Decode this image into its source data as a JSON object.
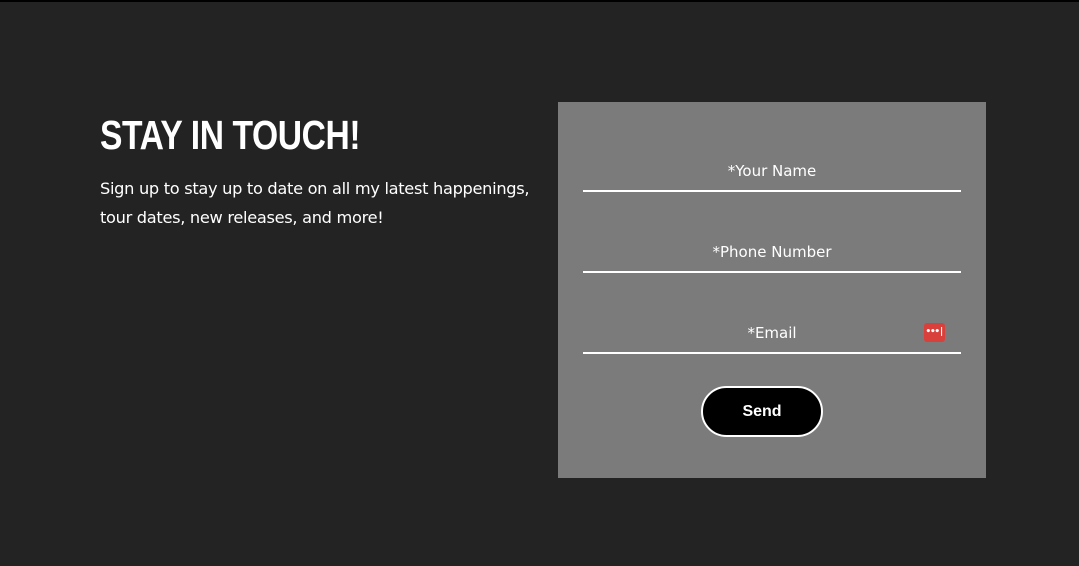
{
  "intro": {
    "headline": "STAY IN TOUCH!",
    "subtext": "Sign up to stay up to date on all my latest happenings, tour dates, new releases, and more!"
  },
  "form": {
    "fields": {
      "name": {
        "placeholder": "*Your Name",
        "value": ""
      },
      "phone": {
        "placeholder": "*Phone Number",
        "value": ""
      },
      "email": {
        "placeholder": "*Email",
        "value": ""
      }
    },
    "password_manager_icon": "password-manager-icon",
    "send_label": "Send"
  },
  "colors": {
    "page_background": "#232323",
    "panel_background": "#7b7b7b",
    "button_background": "#000000",
    "text": "#ffffff",
    "icon_badge": "#d9403c"
  }
}
